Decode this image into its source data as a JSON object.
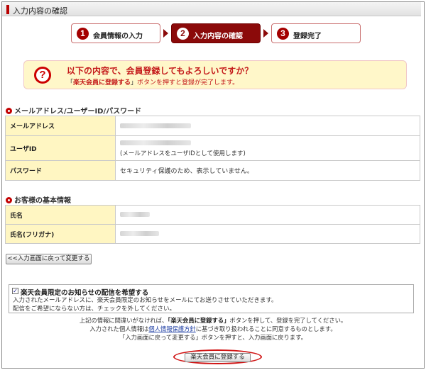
{
  "header": {
    "title": "入力内容の確認"
  },
  "steps": [
    {
      "num": "1",
      "label": "会員情報の入力"
    },
    {
      "num": "2",
      "label": "入力内容の確認"
    },
    {
      "num": "3",
      "label": "登録完了"
    }
  ],
  "confirm": {
    "icon": "?",
    "main": "以下の内容で、会員登録してもよろしいですか？",
    "sub_quote_open": "「",
    "sub_button": "楽天会員に登録する",
    "sub_quote_close": "」",
    "sub_rest": "ボタンを押すと登録が完了します。"
  },
  "section1": {
    "title": "メールアドレス/ユーザーID/パスワード",
    "rows": [
      {
        "label": "メールアドレス",
        "value": ""
      },
      {
        "label": "ユーザID",
        "value": "",
        "note": "(メールアドレスをユーザIDとして使用します)"
      },
      {
        "label": "パスワード",
        "value": "セキュリティ保護のため、表示していません。"
      }
    ]
  },
  "section2": {
    "title": "お客様の基本情報",
    "rows": [
      {
        "label": "氏名",
        "value": ""
      },
      {
        "label": "氏名(フリガナ)",
        "value": ""
      }
    ]
  },
  "back_button": {
    "label": "<<入力画面に戻って変更する"
  },
  "notice": {
    "checkbox_mark": "✓",
    "title": "楽天会員限定のお知らせの配信を希望する",
    "line2": "入力されたメールアドレスに、楽天会員限定のお知らせをメールにてお送りさせていただきます。",
    "line3": "配信をご希望にならない方は、チェックを外してください。"
  },
  "footer": {
    "line1_a": "上記の情報に間違いがなければ、",
    "line1_b": "「楽天会員に登録する」",
    "line1_c": "ボタンを押して、登録を完了してください。",
    "line2_a": "入力された個人情報は",
    "line2_link": "個人情報保護方針",
    "line2_c": "に基づき取り扱われることに同意するものとします。",
    "line3": "「入力画面に戻って変更する」ボタンを押すと、入力画面に戻ります。"
  },
  "submit_button": {
    "label": "楽天会員に登録する"
  },
  "colors": {
    "accent": "#8b0a0a",
    "highlight_box": "#fff7c9",
    "label_cell": "#fff6c2"
  }
}
